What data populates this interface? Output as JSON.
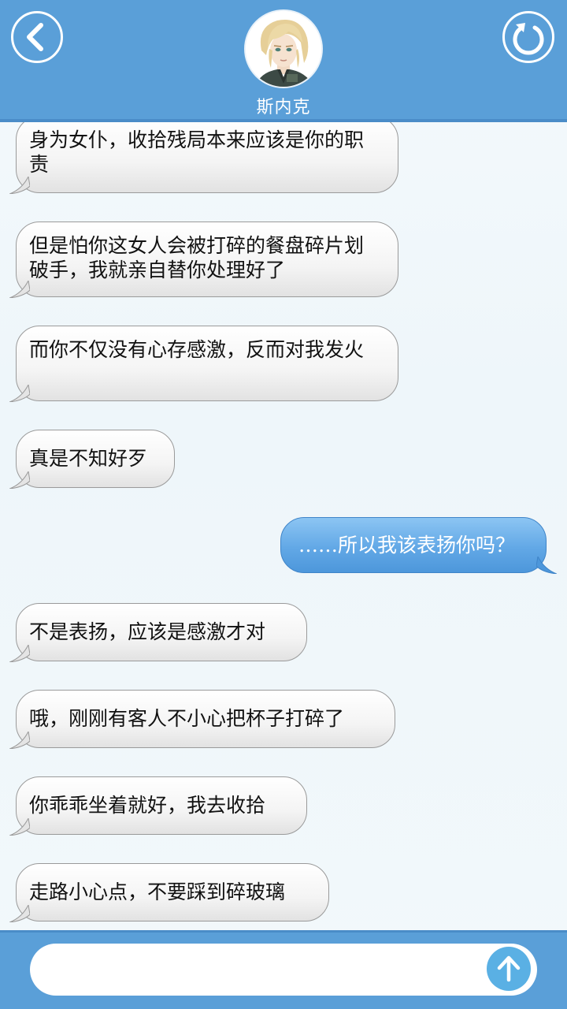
{
  "header": {
    "contact_name": "斯内克",
    "back_icon": "chevron-left-icon",
    "refresh_icon": "refresh-icon"
  },
  "messages": [
    {
      "side": "in",
      "text": "身为女仆，收拾残局本来应该是你的职责"
    },
    {
      "side": "in",
      "text": "但是怕你这女人会被打碎的餐盘碎片划破手，我就亲自替你处理好了"
    },
    {
      "side": "in",
      "text": "而你不仅没有心存感激，反而对我发火"
    },
    {
      "side": "in",
      "text": "真是不知好歹"
    },
    {
      "side": "out",
      "text": "……所以我该表扬你吗？"
    },
    {
      "side": "in",
      "text": "不是表扬，应该是感激才对"
    },
    {
      "side": "in",
      "text": "哦，刚刚有客人不小心把杯子打碎了"
    },
    {
      "side": "in",
      "text": "你乖乖坐着就好，我去收拾"
    },
    {
      "side": "in",
      "text": "走路小心点，不要踩到碎玻璃"
    }
  ],
  "composer": {
    "value": "",
    "placeholder": "",
    "send_icon": "arrow-up-icon"
  },
  "colors": {
    "header_bg": "#5a9fd8",
    "outgoing_bubble": "#62a8e6",
    "incoming_bubble": "#f4f4f4",
    "send_button": "#5ab0e4"
  }
}
